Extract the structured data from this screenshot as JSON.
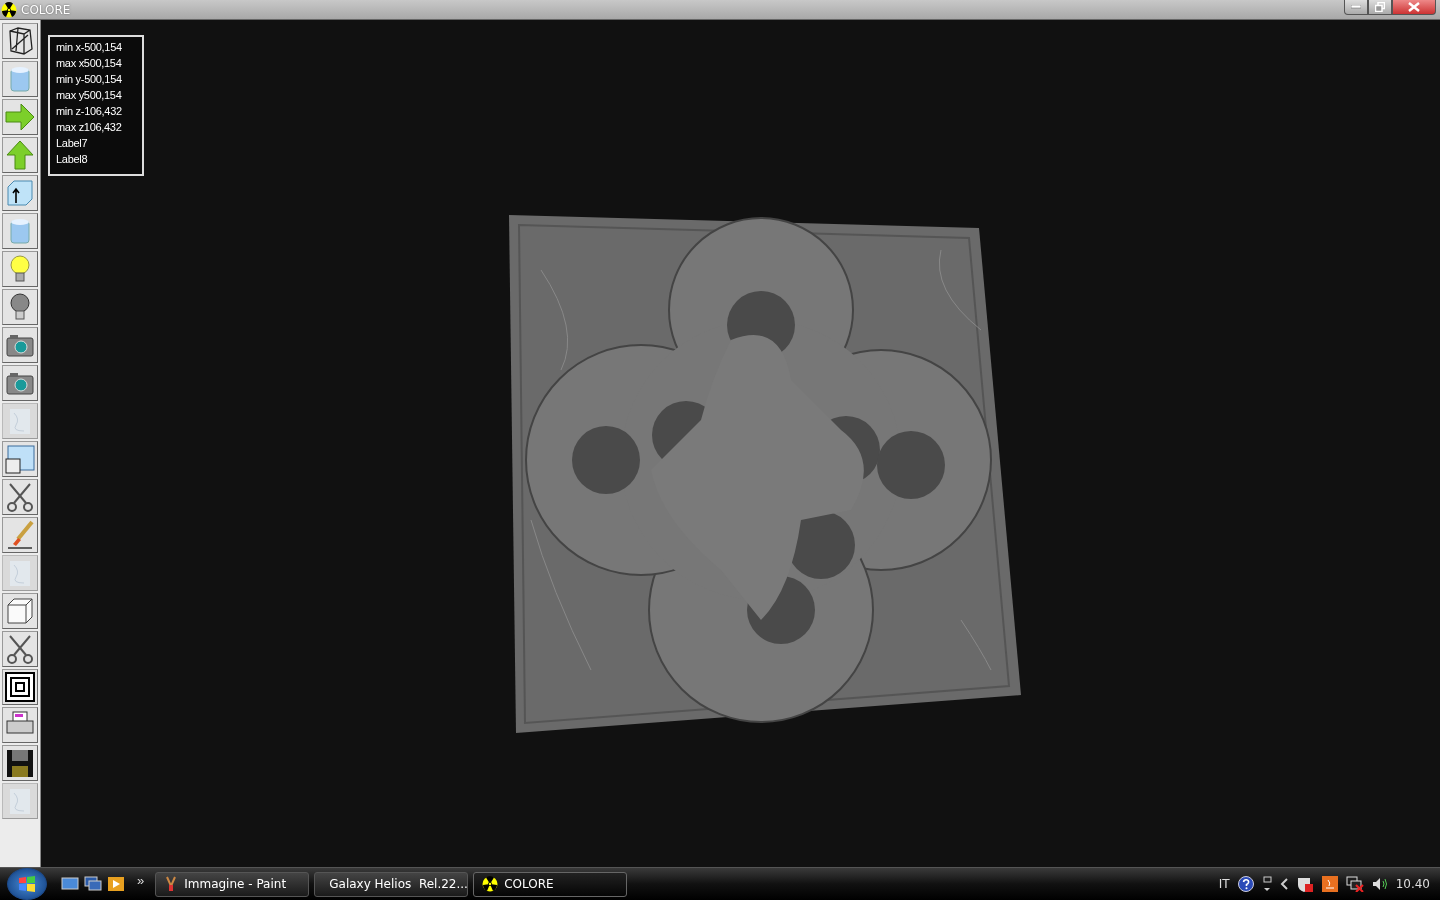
{
  "window": {
    "title": "COLORE"
  },
  "toolbar": [
    {
      "kind": "wireframe",
      "disabled": false
    },
    {
      "kind": "cylinder",
      "disabled": false
    },
    {
      "kind": "arrow-right",
      "disabled": false
    },
    {
      "kind": "arrow-up",
      "disabled": false
    },
    {
      "kind": "box-arrow",
      "disabled": false
    },
    {
      "kind": "cylinder",
      "disabled": false
    },
    {
      "kind": "bulb-on",
      "disabled": false
    },
    {
      "kind": "bulb-off",
      "disabled": false
    },
    {
      "kind": "camera",
      "disabled": false
    },
    {
      "kind": "camera",
      "disabled": false
    },
    {
      "kind": "texture",
      "disabled": true
    },
    {
      "kind": "panes",
      "disabled": false
    },
    {
      "kind": "scissors",
      "disabled": false
    },
    {
      "kind": "brush",
      "disabled": false
    },
    {
      "kind": "texture",
      "disabled": true
    },
    {
      "kind": "cube",
      "disabled": false
    },
    {
      "kind": "scissors",
      "disabled": false
    },
    {
      "kind": "squares",
      "disabled": false
    },
    {
      "kind": "printer",
      "disabled": false
    },
    {
      "kind": "floppy",
      "disabled": false
    },
    {
      "kind": "texture",
      "disabled": true
    }
  ],
  "info_panel": {
    "lines": [
      "min x-500,154",
      "max x500,154",
      "min y-500,154",
      "max y500,154",
      "min z-106,432",
      "max z106,432",
      "Label7",
      "Label8"
    ]
  },
  "taskbar": {
    "overflow": "»",
    "tasks": [
      {
        "label": "Immagine - Paint",
        "kind": "paint",
        "selected": false
      },
      {
        "label": "Galaxy Helios  Rel.22...",
        "kind": "app",
        "selected": false
      },
      {
        "label": "COLORE",
        "kind": "radiation",
        "selected": true
      }
    ],
    "language": "IT",
    "clock": "10.40"
  }
}
